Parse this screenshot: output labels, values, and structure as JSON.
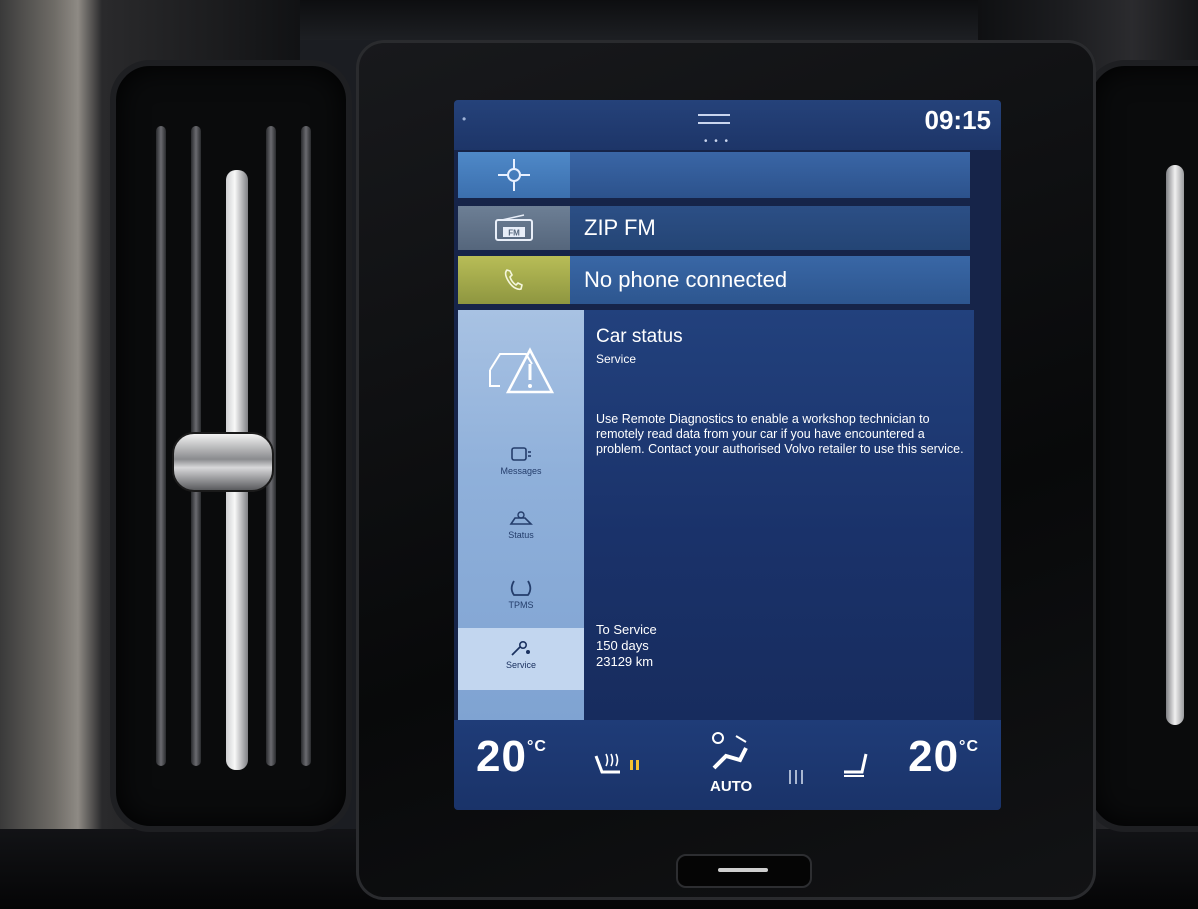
{
  "status_bar": {
    "time": "09:15"
  },
  "tiles": {
    "navigation": {
      "label": ""
    },
    "radio": {
      "label": "ZIP FM",
      "icon_text": "FM"
    },
    "phone": {
      "label": "No phone connected"
    }
  },
  "car_status": {
    "title": "Car status",
    "subtitle": "Service",
    "description": "Use Remote Diagnostics to enable a workshop technician to remotely read data from your car if you have encountered a problem. Contact your authorised Volvo retailer to use this service.",
    "service_header": "To Service",
    "service_days": "150 days",
    "service_km": "23129 km",
    "sidebar": [
      {
        "label": "Messages"
      },
      {
        "label": "Status"
      },
      {
        "label": "TPMS"
      },
      {
        "label": "Service"
      }
    ]
  },
  "climate": {
    "temp_left": "20",
    "temp_right": "20",
    "unit": "°C",
    "auto_label": "AUTO"
  },
  "colors": {
    "accent_phone": "#b8bd57",
    "screen_bg": "#162449"
  }
}
